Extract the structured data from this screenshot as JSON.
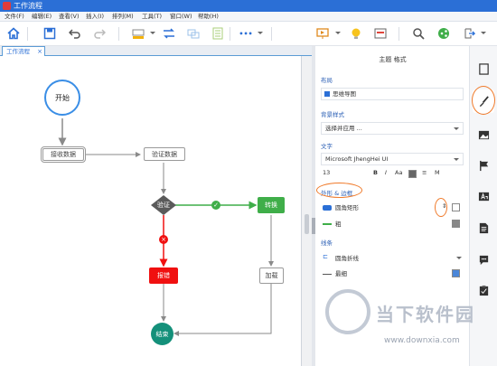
{
  "app": {
    "title": "工作流程"
  },
  "menu": [
    "文件(F)",
    "编辑(E)",
    "查看(V)",
    "插入(I)",
    "排列(M)",
    "工具(T)",
    "窗口(W)",
    "帮助(H)"
  ],
  "toolbar": {
    "icons": [
      "home-icon",
      "save-icon",
      "undo-icon",
      "redo-icon",
      "fill-icon",
      "connector-icon",
      "layers-icon",
      "list-icon",
      "more-icon",
      "presentation-icon",
      "idea-icon",
      "screen-icon",
      "search-icon",
      "share-icon",
      "export-icon"
    ],
    "more_label": "•••"
  },
  "tab": {
    "label": "工作流程",
    "close": "×"
  },
  "flow": {
    "start": "开始",
    "receive": "接收数据",
    "validate": "验证数据",
    "decision": "验证",
    "convert": "转换",
    "alarm": "报错",
    "load": "加载",
    "end": "结束",
    "yes_mark": "✓",
    "no_mark": "×"
  },
  "panel": {
    "header": "主题  格式",
    "layout_label": "布局",
    "layout_value": "思维导图",
    "style_label": "背景样式",
    "style_value": "选择并应用 ...",
    "text_label": "文字",
    "font_value": "Microsoft JhengHei UI",
    "size_value": "13",
    "text_buttons": [
      "B",
      "I",
      "Aa",
      "≡",
      "M"
    ],
    "shape_label": "外形 & 边框",
    "shape_value": "圆角矩形",
    "border_value": "粗",
    "line_label": "线条",
    "line_value": "圆角折线",
    "line_weight": "最细"
  },
  "colors": {
    "accent": "#2b6fd6",
    "start_border": "#3a8ee6",
    "green": "#3fae49",
    "red": "#f01010",
    "end": "#14907a",
    "annotation": "#f07a2a"
  },
  "sidebar_icons": [
    "page-icon",
    "brush-icon",
    "image-icon",
    "flag-icon",
    "text-icon",
    "document-icon",
    "comment-icon",
    "clipboard-icon"
  ],
  "watermark": {
    "name": "当下软件园",
    "url": "www.downxia.com"
  }
}
